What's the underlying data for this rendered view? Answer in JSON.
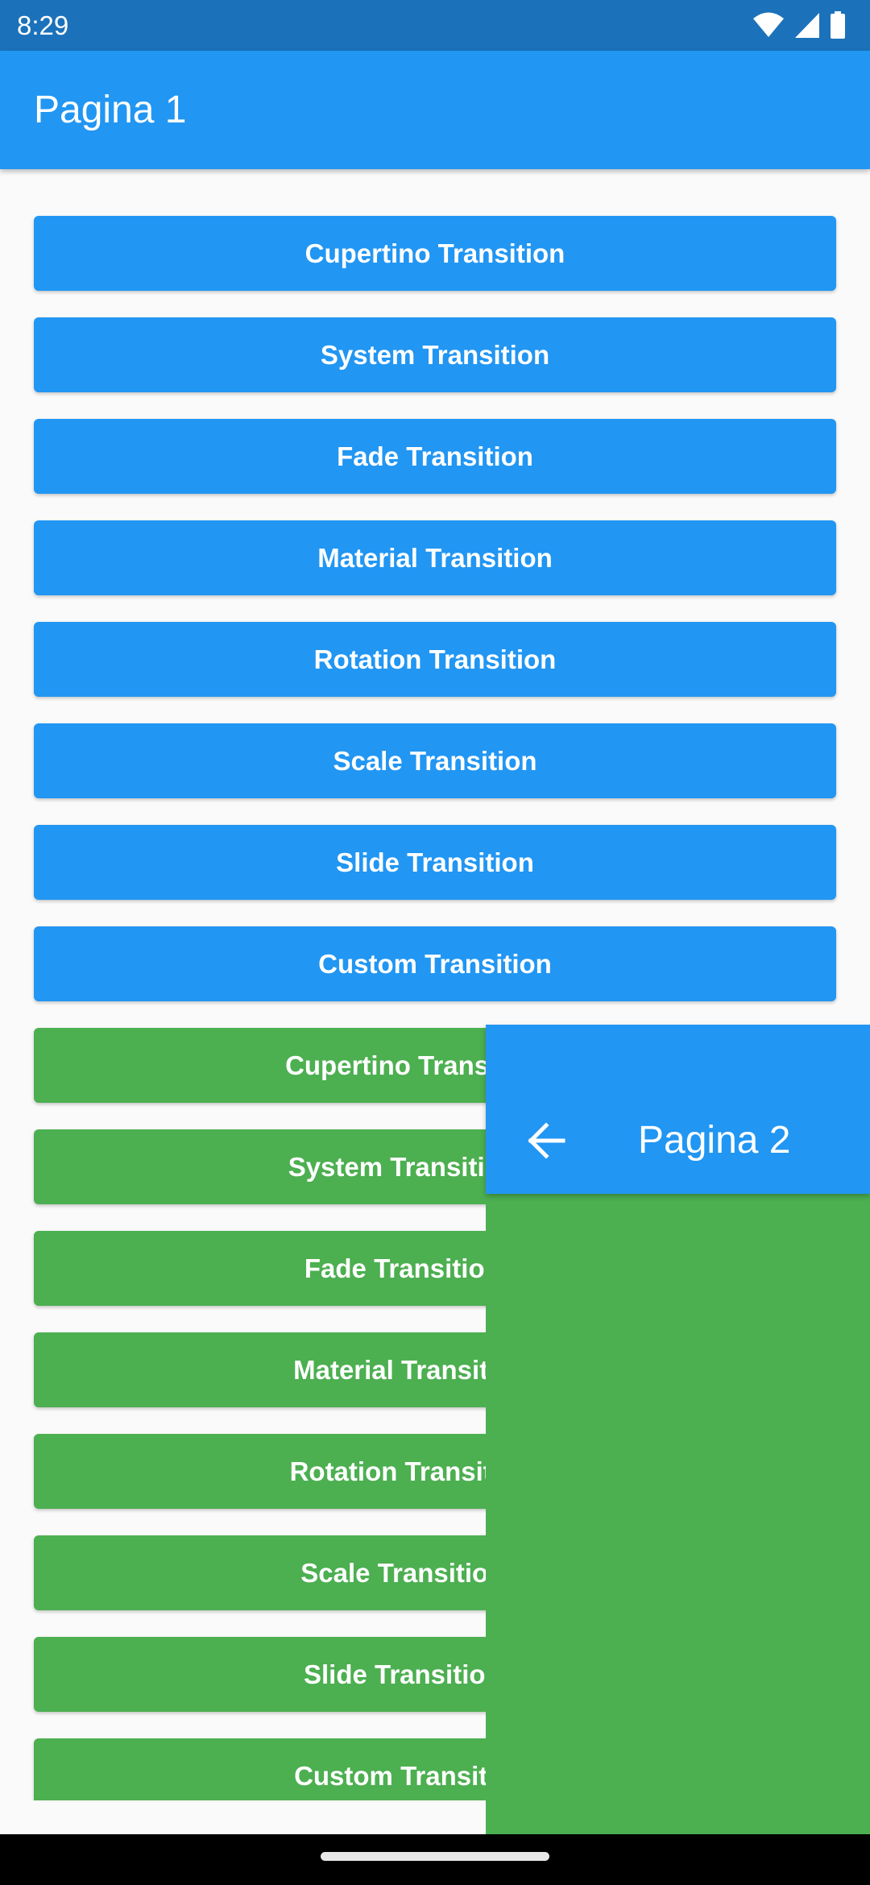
{
  "status_bar": {
    "time": "8:29",
    "icons": [
      "wifi-icon",
      "signal-icon",
      "battery-icon"
    ]
  },
  "app_bar": {
    "title": "Pagina 1"
  },
  "colors": {
    "status_bar": "#1b72ba",
    "primary": "#2196f3",
    "green": "#4caf50",
    "background": "#fafafa"
  },
  "buttons": [
    {
      "label": "Cupertino Transition",
      "color": "blue"
    },
    {
      "label": "System Transition",
      "color": "blue"
    },
    {
      "label": "Fade Transition",
      "color": "blue"
    },
    {
      "label": "Material Transition",
      "color": "blue"
    },
    {
      "label": "Rotation Transition",
      "color": "blue"
    },
    {
      "label": "Scale Transition",
      "color": "blue"
    },
    {
      "label": "Slide Transition",
      "color": "blue"
    },
    {
      "label": "Custom Transition",
      "color": "blue"
    },
    {
      "label": "Cupertino Transition Wi",
      "color": "green"
    },
    {
      "label": "System Transition With",
      "color": "green"
    },
    {
      "label": "Fade Transition With",
      "color": "green"
    },
    {
      "label": "Material Transition Wit",
      "color": "green"
    },
    {
      "label": "Rotation Transition Wit",
      "color": "green"
    },
    {
      "label": "Scale Transition With",
      "color": "green"
    },
    {
      "label": "Slide Transition With",
      "color": "green"
    },
    {
      "label": "Custom Transition Wit",
      "color": "green"
    }
  ],
  "overlay_page": {
    "title": "Pagina 2",
    "back_icon": "arrow-back-icon"
  }
}
